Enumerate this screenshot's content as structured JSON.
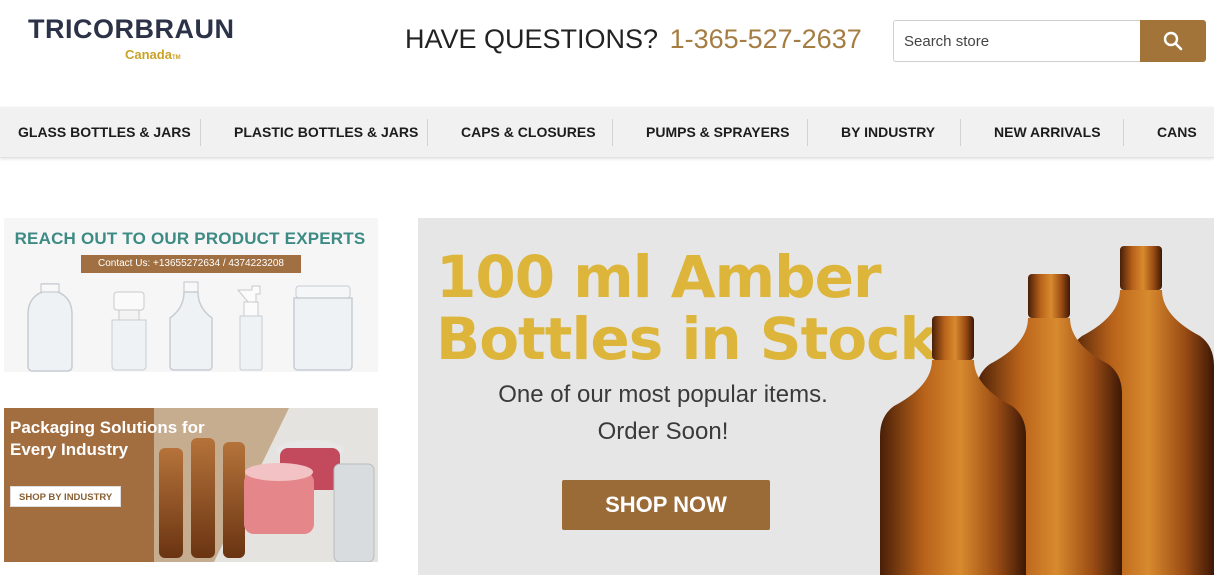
{
  "header": {
    "logo_text": "TRICORBRAUN",
    "logo_sub": "Canada",
    "logo_tm": "TM",
    "questions_label": "HAVE QUESTIONS?",
    "phone": "1-365-527-2637"
  },
  "search": {
    "placeholder": "Search store",
    "button_icon": "search-icon"
  },
  "nav": {
    "items": [
      {
        "label": "GLASS BOTTLES & JARS"
      },
      {
        "label": "PLASTIC BOTTLES & JARS"
      },
      {
        "label": "CAPS & CLOSURES"
      },
      {
        "label": "PUMPS & SPRAYERS"
      },
      {
        "label": "BY INDUSTRY"
      },
      {
        "label": "NEW ARRIVALS"
      },
      {
        "label": "CANS"
      }
    ]
  },
  "experts_banner": {
    "title": "REACH OUT TO OUR PRODUCT EXPERTS",
    "contact": "Contact Us: +13655272634 / 4374223208"
  },
  "industry_banner": {
    "title": "Packaging Solutions for Every Industry",
    "button": "SHOP BY INDUSTRY"
  },
  "hero": {
    "title_line1": "100 ml Amber",
    "title_line2": "Bottles in Stock",
    "subtitle_line1": "One of our most popular items.",
    "subtitle_line2": "Order Soon!",
    "button": "SHOP NOW"
  },
  "colors": {
    "brand_dark": "#2c3247",
    "brand_gold": "#c9a227",
    "accent_brown": "#a2743a",
    "hero_yellow": "#dcb53a",
    "teal": "#3d8b84"
  }
}
